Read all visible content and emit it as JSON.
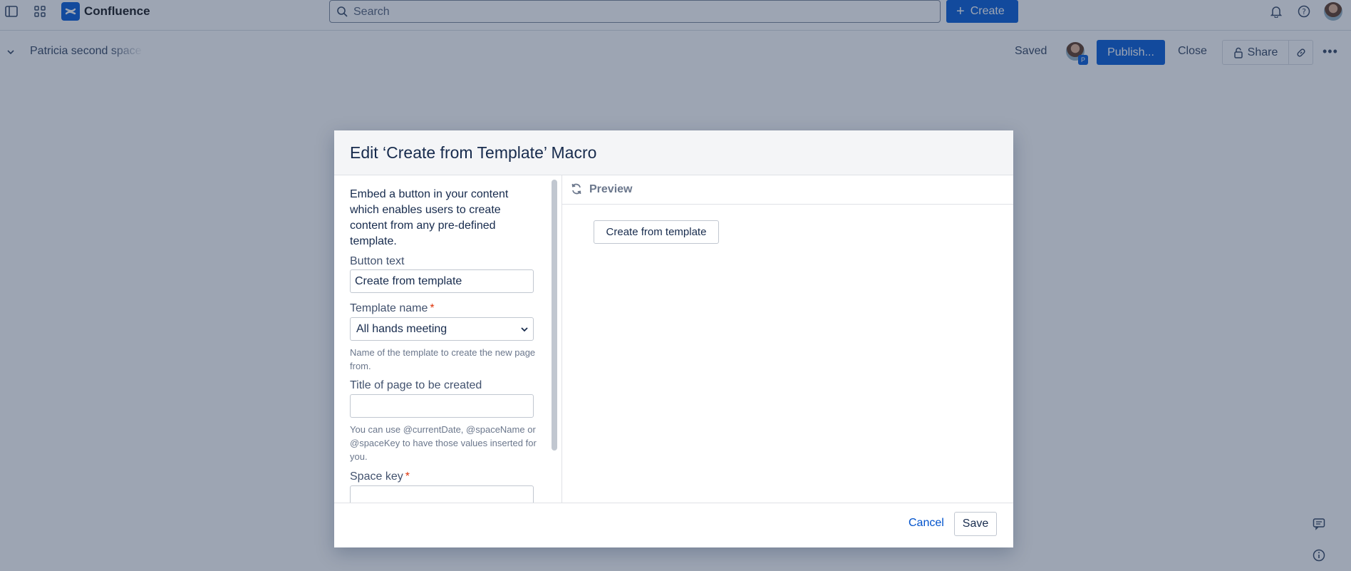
{
  "topnav": {
    "app_name": "Confluence",
    "search_placeholder": "Search",
    "create_label": "Create"
  },
  "editbar": {
    "space_name": "Patricia second space",
    "saved_label": "Saved",
    "avatar_badge": "P",
    "publish_label": "Publish...",
    "close_label": "Close",
    "share_label": "Share"
  },
  "dialog": {
    "title": "Edit ‘Create from Template’ Macro",
    "description": "Embed a button in your content which enables users to create content from any pre-defined template.",
    "button_text_label": "Button text",
    "button_text_value": "Create from template",
    "template_name_label": "Template name",
    "template_name_required": "*",
    "template_name_value": "All hands meeting",
    "template_name_help": "Name of the template to create the new page from.",
    "page_title_label": "Title of page to be created",
    "page_title_value": "",
    "page_title_help": "You can use @currentDate, @spaceName or @spaceKey to have those values inserted for you.",
    "space_key_label": "Space key",
    "space_key_required": "*",
    "preview_title": "Preview",
    "preview_button": "Create from template",
    "cancel_label": "Cancel",
    "save_label": "Save"
  },
  "colors": {
    "brand": "#1868db",
    "required": "#de350b",
    "link": "#0052cc"
  }
}
